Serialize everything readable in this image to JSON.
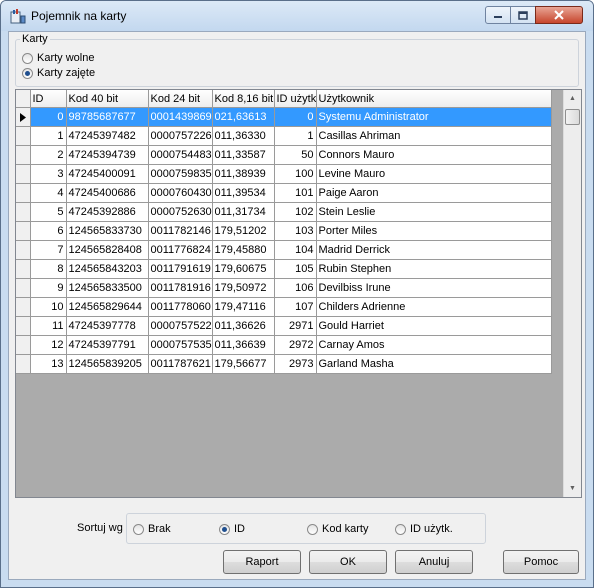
{
  "window": {
    "title": "Pojemnik na karty"
  },
  "karty_group": {
    "label": "Karty",
    "options": [
      {
        "label": "Karty wolne",
        "selected": false
      },
      {
        "label": "Karty zajęte",
        "selected": true
      }
    ]
  },
  "grid": {
    "columns": [
      "ID",
      "Kod 40 bit",
      "Kod 24 bit",
      "Kod 8,16 bit",
      "ID użytk",
      "Użytkownik"
    ],
    "rows": [
      [
        "0",
        "98785687677",
        "0001439869",
        "021,63613",
        "0",
        "Systemu Administrator"
      ],
      [
        "1",
        "47245397482",
        "0000757226",
        "011,36330",
        "1",
        "Casillas Ahriman"
      ],
      [
        "2",
        "47245394739",
        "0000754483",
        "011,33587",
        "50",
        "Connors Mauro"
      ],
      [
        "3",
        "47245400091",
        "0000759835",
        "011,38939",
        "100",
        "Levine Mauro"
      ],
      [
        "4",
        "47245400686",
        "0000760430",
        "011,39534",
        "101",
        "Paige Aaron"
      ],
      [
        "5",
        "47245392886",
        "0000752630",
        "011,31734",
        "102",
        "Stein Leslie"
      ],
      [
        "6",
        "124565833730",
        "0011782146",
        "179,51202",
        "103",
        "Porter Miles"
      ],
      [
        "7",
        "124565828408",
        "0011776824",
        "179,45880",
        "104",
        "Madrid Derrick"
      ],
      [
        "8",
        "124565843203",
        "0011791619",
        "179,60675",
        "105",
        "Rubin Stephen"
      ],
      [
        "9",
        "124565833500",
        "0011781916",
        "179,50972",
        "106",
        "Devilbiss Irune"
      ],
      [
        "10",
        "124565829644",
        "0011778060",
        "179,47116",
        "107",
        "Childers Adrienne"
      ],
      [
        "11",
        "47245397778",
        "0000757522",
        "011,36626",
        "2971",
        "Gould Harriet"
      ],
      [
        "12",
        "47245397791",
        "0000757535",
        "011,36639",
        "2972",
        "Carnay Amos"
      ],
      [
        "13",
        "124565839205",
        "0011787621",
        "179,56677",
        "2973",
        "Garland Masha"
      ]
    ],
    "selected_row": 0,
    "row_indicator_icon": "current-row-arrow-icon"
  },
  "sort_group": {
    "label": "Sortuj wg",
    "options": [
      {
        "label": "Brak",
        "selected": false
      },
      {
        "label": "ID",
        "selected": true
      },
      {
        "label": "Kod karty",
        "selected": false
      },
      {
        "label": "ID użytk.",
        "selected": false
      }
    ]
  },
  "buttons": {
    "raport": "Raport",
    "ok": "OK",
    "anuluj": "Anuluj",
    "pomoc": "Pomoc"
  },
  "colors": {
    "selection": "#3399ff",
    "title_bar": "#c9dcf0",
    "close_button": "#c7452c"
  }
}
